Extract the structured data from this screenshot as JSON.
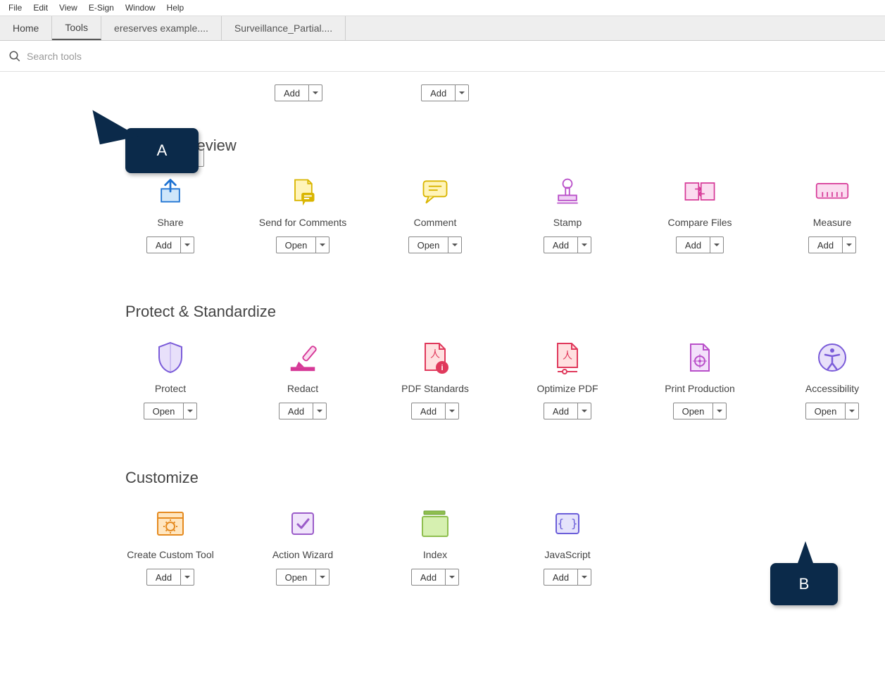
{
  "menu": {
    "items": [
      "File",
      "Edit",
      "View",
      "E-Sign",
      "Window",
      "Help"
    ]
  },
  "tabs": {
    "home": "Home",
    "tools": "Tools",
    "docs": [
      "ereserves example....",
      "Surveillance_Partial...."
    ]
  },
  "search": {
    "placeholder": "Search tools"
  },
  "buttons": {
    "add": "Add",
    "open": "Open"
  },
  "topRow": [
    {
      "btn": "Add"
    },
    {
      "btn": "Add"
    }
  ],
  "sections": [
    {
      "title": "Share & Review",
      "tools": [
        {
          "name": "Share",
          "btn": "Add",
          "icon": "share"
        },
        {
          "name": "Send for Comments",
          "btn": "Open",
          "icon": "send-comments"
        },
        {
          "name": "Comment",
          "btn": "Open",
          "icon": "comment"
        },
        {
          "name": "Stamp",
          "btn": "Add",
          "icon": "stamp"
        },
        {
          "name": "Compare Files",
          "btn": "Add",
          "icon": "compare"
        },
        {
          "name": "Measure",
          "btn": "Add",
          "icon": "measure"
        }
      ]
    },
    {
      "title": "Protect & Standardize",
      "tools": [
        {
          "name": "Protect",
          "btn": "Open",
          "icon": "protect"
        },
        {
          "name": "Redact",
          "btn": "Add",
          "icon": "redact"
        },
        {
          "name": "PDF Standards",
          "btn": "Add",
          "icon": "pdf-standards"
        },
        {
          "name": "Optimize PDF",
          "btn": "Add",
          "icon": "optimize"
        },
        {
          "name": "Print Production",
          "btn": "Open",
          "icon": "print-production"
        },
        {
          "name": "Accessibility",
          "btn": "Open",
          "icon": "accessibility"
        }
      ]
    },
    {
      "title": "Customize",
      "tools": [
        {
          "name": "Create Custom Tool",
          "btn": "Add",
          "icon": "custom-tool"
        },
        {
          "name": "Action Wizard",
          "btn": "Open",
          "icon": "action-wizard"
        },
        {
          "name": "Index",
          "btn": "Add",
          "icon": "index"
        },
        {
          "name": "JavaScript",
          "btn": "Add",
          "icon": "javascript"
        }
      ]
    }
  ],
  "callouts": {
    "a": "A",
    "b": "B"
  }
}
